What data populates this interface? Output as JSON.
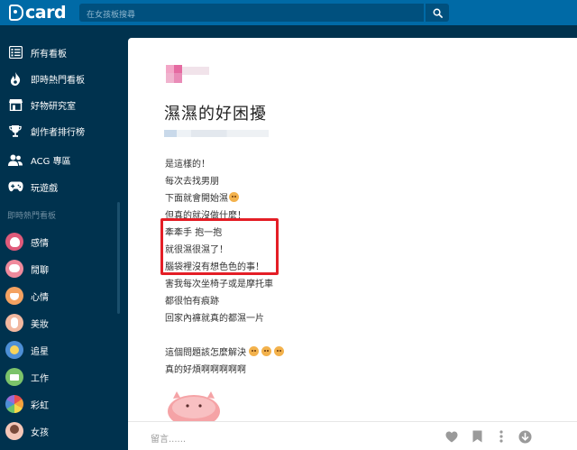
{
  "header": {
    "logo_text": "card",
    "search_placeholder": "在女孩板搜尋"
  },
  "sidebar": {
    "top_items": [
      {
        "label": "所有看板",
        "icon": "list-icon"
      },
      {
        "label": "即時熱門看板",
        "icon": "flame-icon"
      },
      {
        "label": "好物研究室",
        "icon": "store-icon"
      },
      {
        "label": "創作者排行榜",
        "icon": "trophy-icon"
      },
      {
        "label": "ACG 專區",
        "icon": "people-icon"
      },
      {
        "label": "玩遊戲",
        "icon": "gamepad-icon"
      }
    ],
    "section_title": "即時熱門看板",
    "boards": [
      {
        "label": "感情",
        "color": "#e05a7a"
      },
      {
        "label": "閒聊",
        "color": "#f08a9c"
      },
      {
        "label": "心情",
        "color": "#f4a261"
      },
      {
        "label": "美妝",
        "color": "#f2b8a0"
      },
      {
        "label": "追星",
        "color": "#4d8fd6"
      },
      {
        "label": "工作",
        "color": "#7cc36a"
      },
      {
        "label": "彩虹",
        "color": "#e94f4f"
      },
      {
        "label": "女孩",
        "color": "#f5c7b8"
      }
    ]
  },
  "post": {
    "title": "濕濕的好困擾",
    "lines": [
      "是這樣的！",
      "每次去找男朋",
      "下面就會開始濕",
      "但真的就沒做什麼！",
      "牽牽手 抱一抱",
      "就很濕很濕了！",
      "腦袋裡沒有想色色的事！",
      "害我每次坐椅子或是摩托車",
      "都很怕有痕跡",
      "回家內褲就真的都濕一片",
      "",
      "這個問題該怎麼解決",
      "真的好煩啊啊啊啊啊"
    ]
  },
  "actions": {
    "comment_placeholder": "留言......"
  },
  "colors": {
    "topbar": "#006aa6",
    "sidebar": "#00324e",
    "highlight": "#e41e26"
  }
}
